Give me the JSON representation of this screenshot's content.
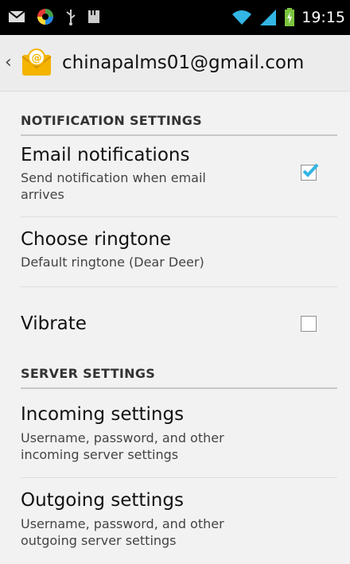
{
  "status_bar": {
    "time": "19:15",
    "icons": [
      "mail-icon",
      "colored-app-icon",
      "usb-icon",
      "storage-icon",
      "wifi-icon",
      "signal-icon",
      "battery-charging-icon"
    ]
  },
  "action_bar": {
    "account": "chinapalms01@gmail.com",
    "up_icon": "chevron-left-icon",
    "app_icon": "email-app-icon"
  },
  "sections": {
    "notification": "NOTIFICATION SETTINGS",
    "server": "SERVER SETTINGS"
  },
  "items": {
    "email_notifications": {
      "title": "Email notifications",
      "summary": "Send notification when email arrives",
      "checked": true
    },
    "ringtone": {
      "title": "Choose ringtone",
      "summary": "Default ringtone (Dear Deer)"
    },
    "vibrate": {
      "title": "Vibrate",
      "checked": false
    },
    "incoming": {
      "title": "Incoming settings",
      "summary": "Username, password, and other incoming server settings"
    },
    "outgoing": {
      "title": "Outgoing settings",
      "summary": "Username, password, and other outgoing server settings"
    }
  },
  "colors": {
    "check_accent": "#33b5e5",
    "status_bar_bg": "#000000",
    "wifi_signal": "#33b5e5",
    "battery_green": "#7cc43f",
    "background": "#f2f2f2"
  }
}
